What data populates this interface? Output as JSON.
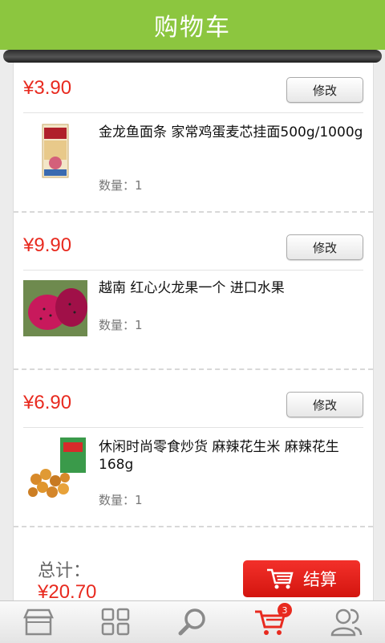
{
  "header": {
    "title": "购物车"
  },
  "items": [
    {
      "price": "¥3.90",
      "edit_label": "修改",
      "name": "金龙鱼面条 家常鸡蛋麦芯挂面500g/1000g",
      "quantity": "数量：1"
    },
    {
      "price": "¥9.90",
      "edit_label": "修改",
      "name": "越南 红心火龙果一个 进口水果",
      "quantity": "数量：1"
    },
    {
      "price": "¥6.90",
      "edit_label": "修改",
      "name": "休闲时尚零食炒货 麻辣花生米 麻辣花生168g",
      "quantity": "数量：1"
    }
  ],
  "footer": {
    "total_label": "总计：",
    "total_value": "¥20.70",
    "checkout_label": "结算"
  },
  "tabbar": {
    "cart_badge": "3"
  },
  "colors": {
    "header": "#8cc63f",
    "price": "#e82a1f",
    "checkout": "#e2201a",
    "tab_active": "#e82a1f",
    "tab_icon": "#8a8a8a"
  },
  "icons": [
    "store-icon",
    "grid-icon",
    "search-icon",
    "cart-icon",
    "user-icon"
  ]
}
